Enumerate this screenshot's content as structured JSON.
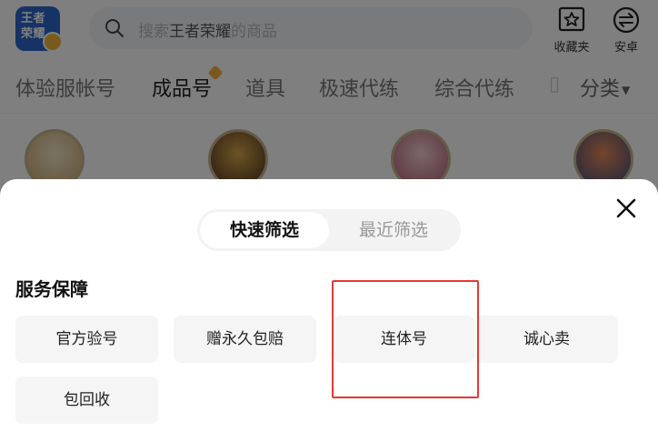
{
  "header": {
    "logo_text": [
      "王者",
      "荣耀"
    ],
    "search_placeholder_prefix": "搜索",
    "search_placeholder_game": "王者荣耀",
    "search_placeholder_suffix": "的商品",
    "favorites_label": "收藏夹",
    "android_label": "安卓"
  },
  "tabs": {
    "items": [
      {
        "label": "体验服帐号",
        "active": false
      },
      {
        "label": "成品号",
        "active": true,
        "badge": true
      },
      {
        "label": "道具",
        "active": false
      },
      {
        "label": "极速代练",
        "active": false
      },
      {
        "label": "综合代练",
        "active": false
      }
    ],
    "category_label": "分类"
  },
  "filter_sheet": {
    "segments": [
      {
        "label": "快速筛选",
        "active": true
      },
      {
        "label": "最近筛选",
        "active": false
      }
    ],
    "service_section": {
      "title": "服务保障",
      "options": [
        "官方验号",
        "赠永久包赔",
        "连体号",
        "诚心卖",
        "包回收"
      ]
    }
  },
  "colors": {
    "highlight": "#e53935",
    "overlay": "rgba(0,0,0,0.5)",
    "chip_bg": "#f5f5f5",
    "brand_blue": "#2a66c8"
  },
  "icons": {
    "search": "search-icon",
    "favorites": "star-box-icon",
    "android": "swap-circle-icon",
    "close": "close-icon"
  }
}
